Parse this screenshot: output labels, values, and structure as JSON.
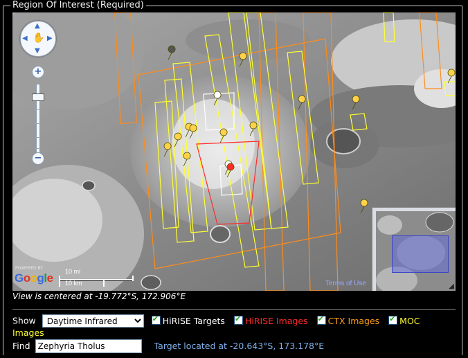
{
  "panel": {
    "legend": "Region Of Interest (Required)"
  },
  "map": {
    "attribution": "Google",
    "powered_by": "POWERED BY",
    "scale_mi": "10 mi",
    "scale_km": "10 km",
    "terms": "Terms of Use",
    "zoom_in": "+",
    "zoom_out": "−"
  },
  "center_text": "View is centered at -19.772°S, 172.906°E",
  "controls": {
    "show_label": "Show",
    "show_selected": "Daytime Infrared",
    "layers": [
      {
        "label": "HiRISE Targets",
        "checked": true,
        "color": "#ffffff"
      },
      {
        "label": "HiRISE Images",
        "checked": true,
        "color": "#ff2b2b"
      },
      {
        "label": "CTX Images",
        "checked": true,
        "color": "#ff9d1f"
      },
      {
        "label": "MOC",
        "checked": true,
        "color": "#ffff33"
      }
    ],
    "moc_wrap": "Images",
    "find_label": "Find",
    "find_value": "Zephyria Tholus",
    "target_text": "Target located at -20.643°S, 173.178°E"
  }
}
